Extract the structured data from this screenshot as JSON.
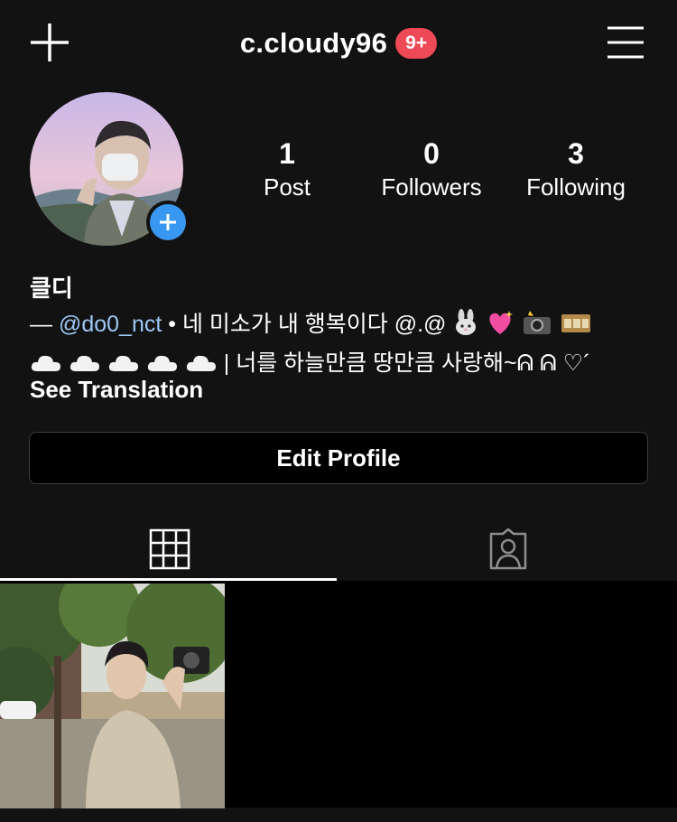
{
  "header": {
    "username": "c.cloudy96",
    "notification_badge": "9+"
  },
  "profile": {
    "display_name": "클디",
    "stats": [
      {
        "value": "1",
        "label": "Post"
      },
      {
        "value": "0",
        "label": "Followers"
      },
      {
        "value": "3",
        "label": "Following"
      }
    ],
    "bio": {
      "prefix": "— ",
      "mention": "@do0_nct",
      "line1_text": " • 네 미소가 내 행복이다 @.@ ",
      "line2_text": " | 너를 하늘만큼 땅만큼 사랑해~ᕱ ᕱ ♡´"
    },
    "see_translation": "See Translation",
    "edit_profile_label": "Edit Profile"
  },
  "tabs": [
    {
      "name": "grid",
      "icon": "grid-icon",
      "active": true
    },
    {
      "name": "tagged",
      "icon": "tagged-person-icon",
      "active": false
    }
  ],
  "icons": {
    "new_post": "plus-icon",
    "menu": "hamburger-menu-icon",
    "add_story": "add-story-plus-icon"
  },
  "colors": {
    "background": "#121212",
    "badge": "#ed4956",
    "accent_blue": "#3897f0",
    "mention": "#9ec8f5"
  }
}
